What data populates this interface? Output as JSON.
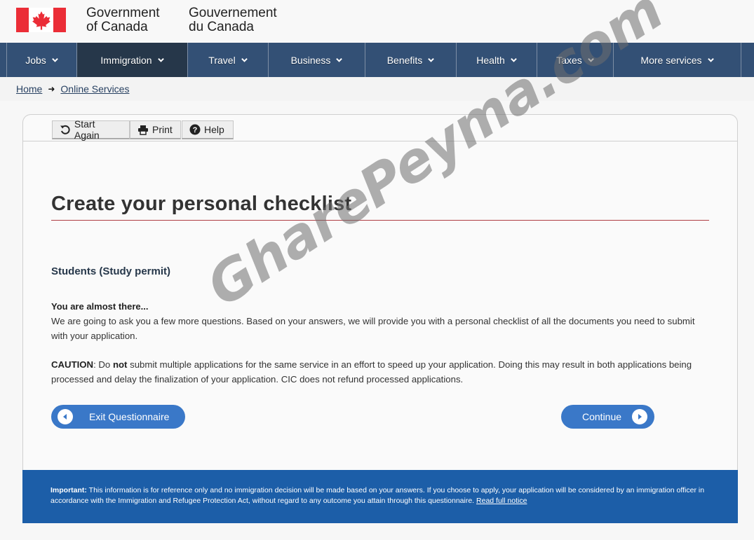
{
  "header": {
    "signature_en_line1": "Government",
    "signature_en_line2": "of Canada",
    "signature_fr_line1": "Gouvernement",
    "signature_fr_line2": "du Canada",
    "flag_icon": "canada-flag-icon"
  },
  "nav": {
    "items": [
      {
        "label": "Jobs",
        "active": false
      },
      {
        "label": "Immigration",
        "active": true
      },
      {
        "label": "Travel",
        "active": false
      },
      {
        "label": "Business",
        "active": false
      },
      {
        "label": "Benefits",
        "active": false
      },
      {
        "label": "Health",
        "active": false
      },
      {
        "label": "Taxes",
        "active": false
      },
      {
        "label": "More services",
        "active": false
      }
    ]
  },
  "breadcrumb": {
    "items": [
      "Home",
      "Online Services"
    ],
    "separator_icon": "arrow-right-icon"
  },
  "toolbar": {
    "start_again": "Start Again",
    "print": "Print",
    "help": "Help"
  },
  "main": {
    "title": "Create your personal checklist",
    "subtitle": "Students (Study permit)",
    "lead": "You are almost there...",
    "paragraph1": "We are going to ask you a few more questions. Based on your answers, we will provide you with a personal checklist of all the documents you need to submit with your application.",
    "caution_label": "CAUTION",
    "caution_pre": ": Do ",
    "caution_not": "not",
    "caution_post": " submit multiple applications for the same service in an effort to speed up your application.  Doing this may result in both applications being processed and delay the finalization of your application. CIC does not refund processed applications.",
    "exit_button": "Exit Questionnaire",
    "continue_button": "Continue"
  },
  "notice": {
    "label": "Important:",
    "text": " This information is for reference only and no immigration decision will be made based on your answers. If you choose to apply, your application will be considered by an immigration officer in accordance with the Immigration and Refugee Protection Act, without regard to any outcome you attain through this questionnaire. ",
    "link": "Read full notice"
  },
  "watermark": {
    "text": "GharePeyma.com - قاره پیما"
  },
  "colors": {
    "nav_bg": "#335075",
    "nav_active": "#26374a",
    "title_rule": "#af3c43",
    "button_blue": "#3a78c8",
    "notice_bg": "#1c5ea8",
    "flag_red": "#eb2d37"
  }
}
